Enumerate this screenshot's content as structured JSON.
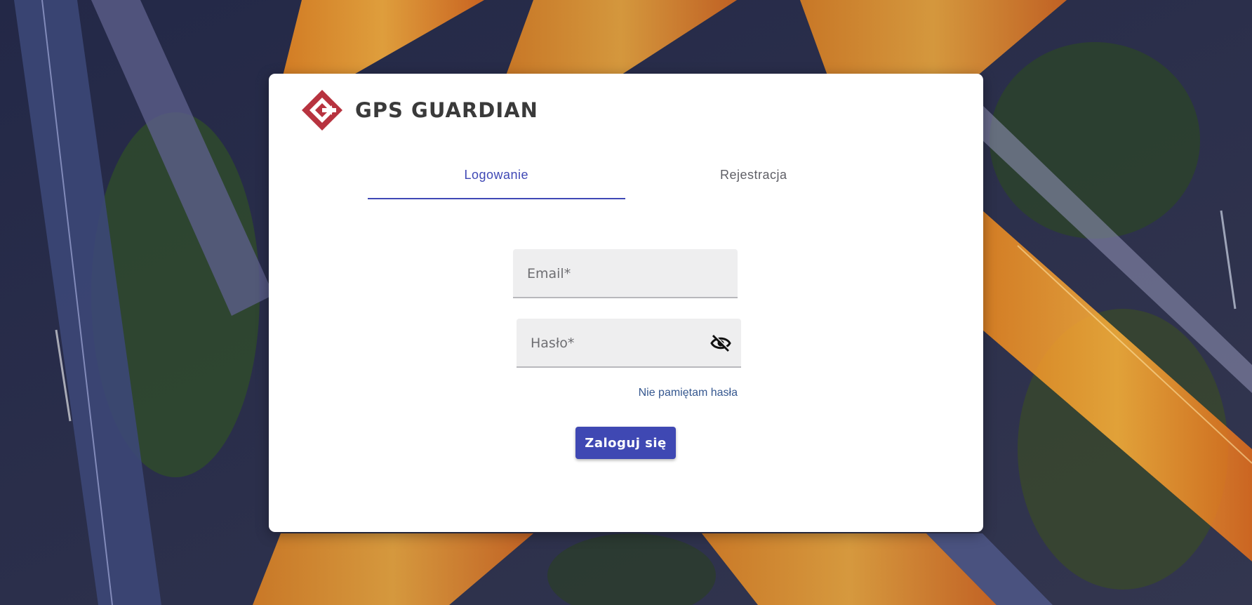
{
  "brand": {
    "name": "GPS GUARDIAN",
    "logo_icon": "gps-guardian-logo-icon",
    "logo_color": "#b7333f"
  },
  "tabs": [
    {
      "label": "Logowanie",
      "active": true
    },
    {
      "label": "Rejestracja",
      "active": false
    }
  ],
  "form": {
    "email_placeholder": "Email*",
    "email_value": "",
    "password_placeholder": "Hasło*",
    "password_value": "",
    "password_toggle_icon": "eye-off-icon",
    "forgot_link": "Nie pamiętam hasła",
    "submit_label": "Zaloguj się"
  },
  "colors": {
    "accent": "#3f48b3",
    "link": "#35578f",
    "card": "#ffffff"
  }
}
